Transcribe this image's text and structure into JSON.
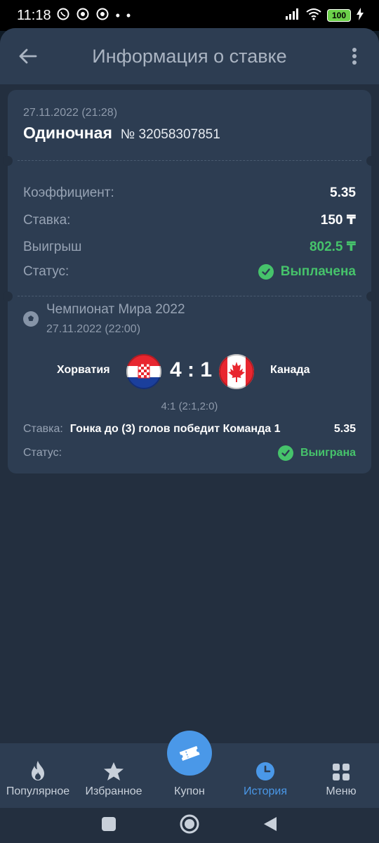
{
  "status_bar": {
    "time": "11:18",
    "battery": "100",
    "more": "• •"
  },
  "header": {
    "title": "Информация о ставке"
  },
  "bet": {
    "placed_at": "27.11.2022 (21:28)",
    "type": "Одиночная",
    "number": "№ 32058307851",
    "odds_label": "Коэффициент:",
    "odds_value": "5.35",
    "stake_label": "Ставка:",
    "stake_value": "150 ₸",
    "win_label": "Выигрыш",
    "win_value": "802.5 ₸",
    "status_label": "Статус:",
    "status_value": "Выплачена"
  },
  "event": {
    "league": "Чемпионат Мира 2022",
    "start_time": "27.11.2022 (22:00)",
    "team_home": "Хорватия",
    "team_away": "Канада",
    "score": "4 : 1",
    "score_detail": "4:1 (2:1,2:0)",
    "bet_label": "Ставка:",
    "bet_description": "Гонка до (3) голов победит Команда 1",
    "bet_odds": "5.35",
    "status_label": "Статус:",
    "status_value": "Выиграна"
  },
  "bottom_nav": {
    "items": [
      {
        "label": "Популярное",
        "icon": "fire-icon"
      },
      {
        "label": "Избранное",
        "icon": "star-icon"
      },
      {
        "label": "Купон",
        "icon": "ticket-icon"
      },
      {
        "label": "История",
        "icon": "clock-icon",
        "active": true
      },
      {
        "label": "Меню",
        "icon": "grid-icon"
      }
    ]
  },
  "colors": {
    "accent": "#4a98e8",
    "success": "#46c36b",
    "card": "#2d3d52",
    "background": "#232f3f"
  }
}
